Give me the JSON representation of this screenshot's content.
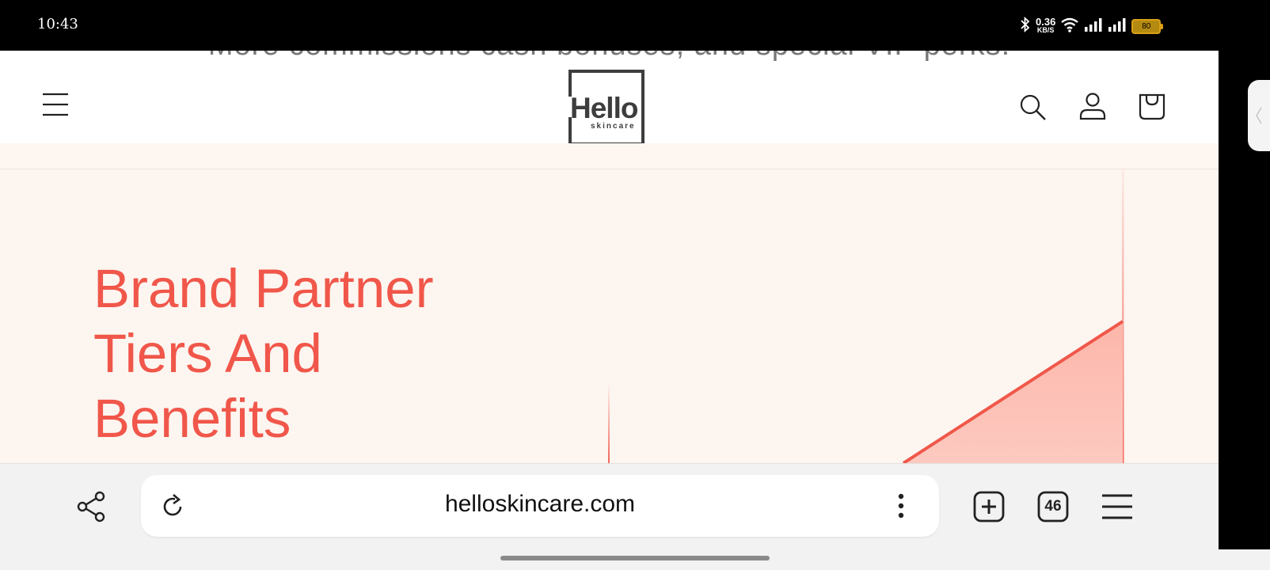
{
  "status_bar": {
    "time": "10:43",
    "network_speed": "0.36",
    "network_unit": "KB/S",
    "battery": "80",
    "icons": [
      "bluetooth-icon",
      "wifi-icon",
      "signal-icon",
      "signal-icon",
      "battery-icon"
    ]
  },
  "site": {
    "promo_text": "More commissions cash bonuses, and special VIP perks.",
    "logo_main": "Hello",
    "logo_sub": "skincare",
    "header_icons": [
      "menu-icon",
      "search-icon",
      "account-icon",
      "cart-icon"
    ]
  },
  "hero": {
    "title_lines": [
      "Brand Partner",
      "Tiers And",
      "Benefits"
    ]
  },
  "colors": {
    "accent": "#f0574a",
    "page_bg": "#fdf5f0",
    "fill": "#fdc2b8"
  },
  "browser": {
    "url": "helloskincare.com",
    "tab_count": "46",
    "icons": [
      "share-icon",
      "reload-icon",
      "more-vertical-icon",
      "new-tab-icon",
      "tabs-icon",
      "browser-menu-icon"
    ]
  }
}
